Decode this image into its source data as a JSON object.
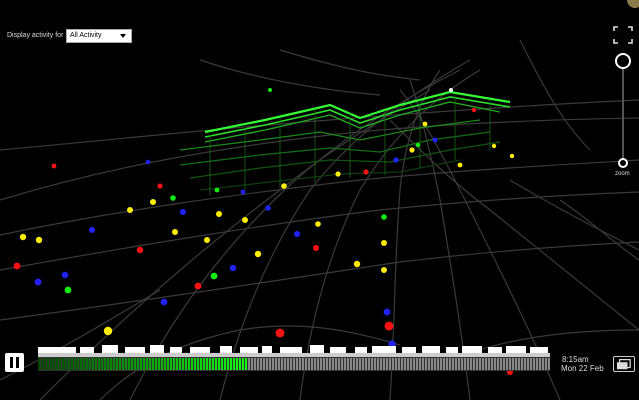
{
  "filter": {
    "label": "Display activity for",
    "selected": "All Activity"
  },
  "zoom": {
    "label": "zoom",
    "level": 0.0
  },
  "playback": {
    "time": "8:15am",
    "date": "Mon 22 Feb",
    "progress": 0.41,
    "state": "playing"
  },
  "colors": {
    "active_line": "#33ff33",
    "progress_fill": "#22dd22",
    "remaining": "#888888",
    "station_yellow": "#ffee00",
    "station_red": "#ff1111",
    "station_blue": "#2222ff",
    "station_green": "#11ee11"
  },
  "icons": {
    "pause": "pause-icon",
    "fullscreen": "fullscreen-icon",
    "screen": "screen-icon"
  }
}
